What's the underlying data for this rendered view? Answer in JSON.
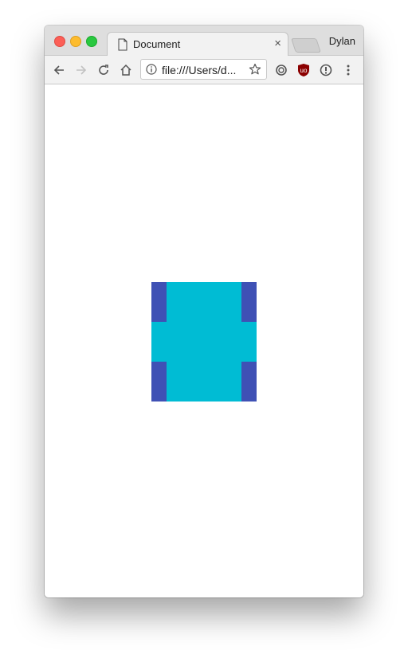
{
  "window": {
    "tab_title": "Document",
    "profile_name": "Dylan",
    "address": "file:///Users/d..."
  },
  "icons": {
    "tab_page": "document-page-icon",
    "tab_close": "close-icon",
    "back": "arrow-left-icon",
    "forward": "arrow-right-icon",
    "reload": "reload-icon",
    "home": "home-icon",
    "info": "info-icon",
    "bookmark": "star-icon",
    "ext_sync": "sync-extension-icon",
    "ext_ublock": "ublock-shield-icon",
    "ext_info": "info-circle-extension-icon",
    "menu": "kebab-menu-icon"
  },
  "colors": {
    "shape_main": "#00bcd4",
    "shape_corners": "#3f51b5",
    "tab_close_glyph": "×"
  }
}
